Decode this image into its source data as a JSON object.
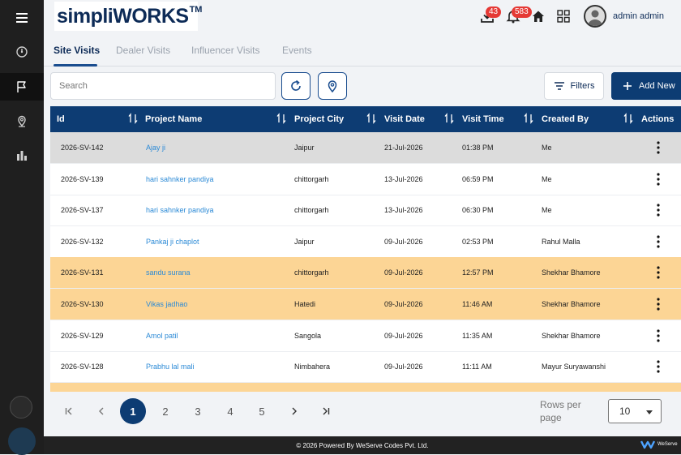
{
  "app": {
    "logo_text": "simpliWORKS",
    "logo_tm": "TM",
    "footer_text": "© 2026 Powered By WeServe Codes Pvt. Ltd.",
    "footer_brand": "WeServe"
  },
  "topbar": {
    "download_badge": "43",
    "notification_badge": "583",
    "user_name": "admin admin"
  },
  "tabs": [
    {
      "label": "Site Visits",
      "active": true
    },
    {
      "label": "Dealer Visits",
      "active": false
    },
    {
      "label": "Influencer Visits",
      "active": false
    },
    {
      "label": "Events",
      "active": false
    }
  ],
  "toolbar": {
    "search_placeholder": "Search",
    "filters_label": "Filters",
    "add_new_label": "Add New"
  },
  "table": {
    "headers": [
      "Id",
      "Project Name",
      "Project City",
      "Visit Date",
      "Visit Time",
      "Created By",
      "Actions"
    ],
    "rows": [
      {
        "id": "2026-SV-142",
        "project": "Ajay ji",
        "city": "Jaipur",
        "date": "21-Jul-2026",
        "time": "01:38 PM",
        "by": "Me",
        "status": "selected"
      },
      {
        "id": "2026-SV-139",
        "project": "hari sahnker pandiya",
        "city": "chittorgarh",
        "date": "13-Jul-2026",
        "time": "06:59 PM",
        "by": "Me",
        "status": "normal"
      },
      {
        "id": "2026-SV-137",
        "project": "hari sahnker pandiya",
        "city": "chittorgarh",
        "date": "13-Jul-2026",
        "time": "06:30 PM",
        "by": "Me",
        "status": "normal"
      },
      {
        "id": "2026-SV-132",
        "project": "Pankaj ji chaplot",
        "city": "Jaipur",
        "date": "09-Jul-2026",
        "time": "02:53 PM",
        "by": "Rahul Malla",
        "status": "normal"
      },
      {
        "id": "2026-SV-131",
        "project": "sandu surana",
        "city": "chittorgarh",
        "date": "09-Jul-2026",
        "time": "12:57 PM",
        "by": "Shekhar Bhamore",
        "status": "highlight"
      },
      {
        "id": "2026-SV-130",
        "project": "Vikas jadhao",
        "city": "Hatedi",
        "date": "09-Jul-2026",
        "time": "11:46 AM",
        "by": "Shekhar Bhamore",
        "status": "highlight"
      },
      {
        "id": "2026-SV-129",
        "project": "Amol patil",
        "city": "Sangola",
        "date": "09-Jul-2026",
        "time": "11:35 AM",
        "by": "Shekhar Bhamore",
        "status": "normal"
      },
      {
        "id": "2026-SV-128",
        "project": "Prabhu lal mali",
        "city": "Nimbahera",
        "date": "09-Jul-2026",
        "time": "11:11 AM",
        "by": "Mayur Suryawanshi",
        "status": "normal"
      },
      {
        "id": "",
        "project": "",
        "city": "",
        "date": "",
        "time": "",
        "by": "",
        "status": "highlight"
      }
    ]
  },
  "pagination": {
    "pages": [
      "1",
      "2",
      "3",
      "4",
      "5"
    ],
    "active_page": "1",
    "rows_per_page_label": "Rows per page",
    "rows_per_page_value": "10"
  },
  "colors": {
    "primary": "#0d3c73",
    "highlight_row": "#fcd595",
    "selected_row": "#dcdcdc",
    "link": "#2b8ad6",
    "badge": "#e53935"
  }
}
